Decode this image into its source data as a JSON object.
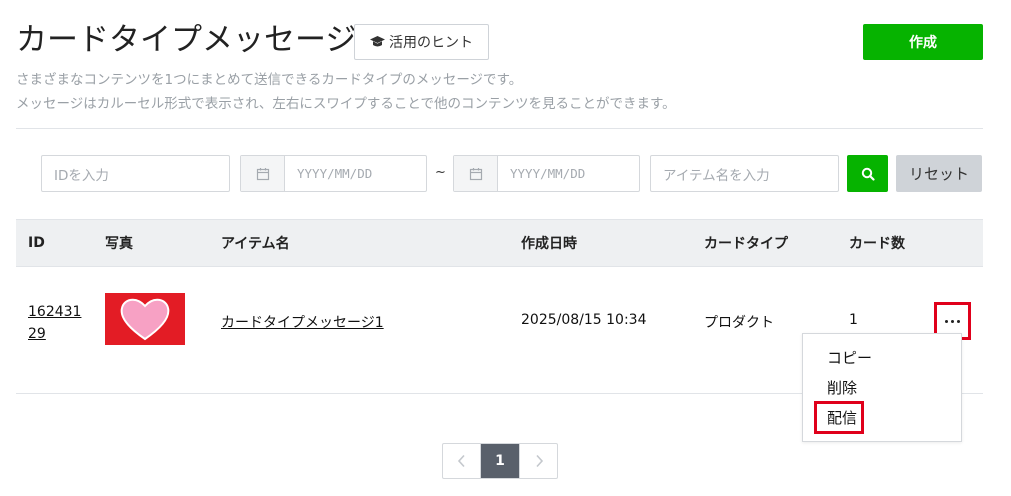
{
  "header": {
    "title": "カードタイプメッセージ",
    "hint_label": "活用のヒント",
    "hint_icon": "graduation-cap-icon",
    "create_label": "作成",
    "description_line1": "さまざまなコンテンツを1つにまとめて送信できるカードタイプのメッセージです。",
    "description_line2": "メッセージはカルーセル形式で表示され、左右にスワイプすることで他のコンテンツを見ることができます。"
  },
  "filters": {
    "id_placeholder": "IDを入力",
    "date_from_placeholder": "YYYY/MM/DD",
    "date_separator": "~",
    "date_to_placeholder": "YYYY/MM/DD",
    "item_placeholder": "アイテム名を入力",
    "search_icon": "search-icon",
    "reset_label": "リセット"
  },
  "table": {
    "columns": [
      "ID",
      "写真",
      "アイテム名",
      "作成日時",
      "カードタイプ",
      "カード数"
    ],
    "rows": [
      {
        "id": "16243129",
        "id_line1": "162431",
        "id_line2": "29",
        "photo": "heart-thumbnail",
        "name": "カードタイプメッセージ1",
        "created": "2025/08/15 10:34",
        "card_type": "プロダクト",
        "card_count": "1"
      }
    ]
  },
  "row_menu": {
    "items": [
      "コピー",
      "削除",
      "配信"
    ]
  },
  "pagination": {
    "current": "1"
  },
  "colors": {
    "primary_green": "#06b300",
    "highlight_red": "#e0001b",
    "thumbnail_red": "#e31c25",
    "heart_pink": "#f7a1c4"
  }
}
